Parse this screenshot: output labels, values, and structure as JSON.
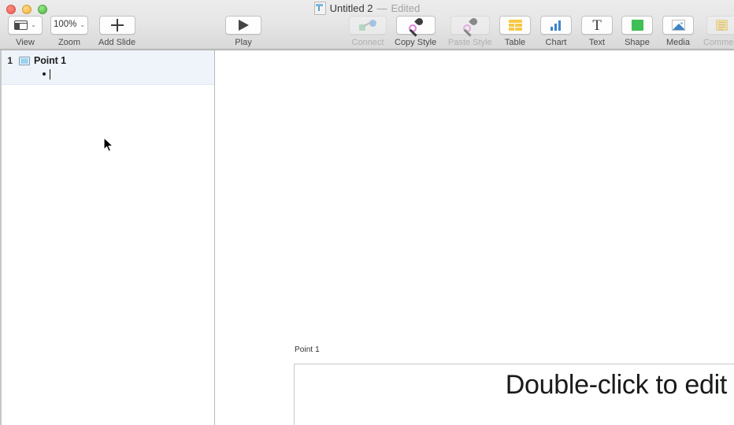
{
  "window": {
    "title": "Untitled 2",
    "separator": "—",
    "status": "Edited",
    "doc_icon": "keynote-document-icon",
    "traffic_lights": [
      {
        "name": "close",
        "color": "#ed6a5e"
      },
      {
        "name": "minimize",
        "color": "#f5bd4f"
      },
      {
        "name": "zoom",
        "color": "#61c555"
      }
    ]
  },
  "toolbar": {
    "items": [
      {
        "label": "View",
        "icon": "view-layout-icon",
        "has_chevron": true,
        "enabled": true
      },
      {
        "label": "Zoom",
        "icon": "zoom-value",
        "value": "100%",
        "has_chevron": true,
        "enabled": true
      },
      {
        "label": "Add Slide",
        "icon": "plus-icon",
        "has_chevron": false,
        "enabled": true
      },
      {
        "label": "Play",
        "icon": "play-icon",
        "has_chevron": false,
        "enabled": true
      },
      {
        "label": "Connect",
        "icon": "connect-icon",
        "has_chevron": false,
        "enabled": false
      },
      {
        "label": "Copy Style",
        "icon": "eyedropper-icon",
        "has_chevron": false,
        "enabled": true
      },
      {
        "label": "Paste Style",
        "icon": "eyedropper-icon",
        "has_chevron": false,
        "enabled": false
      },
      {
        "label": "Table",
        "icon": "table-icon",
        "has_chevron": false,
        "enabled": true
      },
      {
        "label": "Chart",
        "icon": "chart-icon",
        "has_chevron": false,
        "enabled": true
      },
      {
        "label": "Text",
        "icon": "text-icon",
        "has_chevron": false,
        "enabled": true
      },
      {
        "label": "Shape",
        "icon": "shape-icon",
        "has_chevron": false,
        "enabled": true
      },
      {
        "label": "Media",
        "icon": "media-icon",
        "has_chevron": false,
        "enabled": true
      },
      {
        "label": "Comment",
        "icon": "comment-icon",
        "has_chevron": false,
        "enabled": false
      }
    ],
    "text_icon_glyph": "T",
    "chevron_glyph": "⌄"
  },
  "outline": {
    "slide_number": "1",
    "slide_title": "Point 1",
    "bullet_text": "",
    "thumb_icon": "slide-thumbnail-icon"
  },
  "canvas": {
    "slide_label": "Point 1",
    "body_placeholder": "Double-click to edit"
  },
  "colors": {
    "selection": "#eff4fa",
    "toolbar_bg": "#e6e6e6",
    "accent_blue": "#3e86c9",
    "shape_green": "#3fbf55",
    "table_yellow": "#f6c845"
  }
}
